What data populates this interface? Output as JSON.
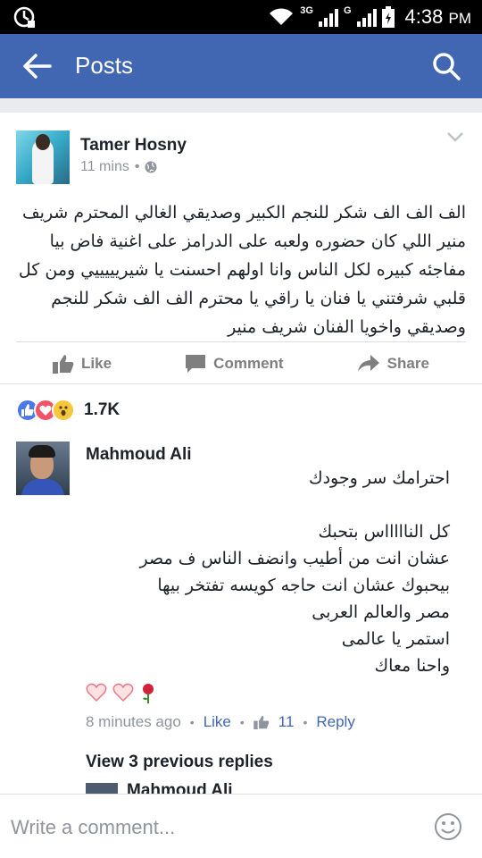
{
  "status": {
    "network_3g": "3G",
    "network_g": "G",
    "time": "4:38",
    "ampm": "PM"
  },
  "appbar": {
    "title": "Posts"
  },
  "post": {
    "author": "Tamer Hosny",
    "time": "11 mins",
    "text": "الف الف الف شكر للنجم الكبير وصديقي الغالي المحترم شريف منير اللي كان حضوره ولعبه على الدرامز على اغنية فاض بيا مفاجئه كبيره لكل الناس وانا اولهم احسنت يا شيريييييي ومن كل قلبي شرفتني يا فنان يا راقي يا محترم الف الف شكر للنجم وصديقي واخويا الفنان شريف منير",
    "actions": {
      "like": "Like",
      "comment": "Comment",
      "share": "Share"
    }
  },
  "reactions": {
    "count": "1.7K"
  },
  "comment": {
    "author": "Mahmoud Ali",
    "text": "احترامك سر وجودك\n\nكل الناااااس بتحبك\nعشان انت من أطيب وانضف الناس ف مصر\nبيحبوك عشان انت حاجه كويسه تفتخر بيها\nمصر والعالم العربى\nاستمر يا عالمى\nواحنا معاك",
    "time": "8 minutes ago",
    "like": "Like",
    "likes_count": "11",
    "reply": "Reply"
  },
  "view_previous": "View 3 previous replies",
  "peek": {
    "author": "Mahmoud Ali"
  },
  "composer": {
    "placeholder": "Write a comment..."
  }
}
